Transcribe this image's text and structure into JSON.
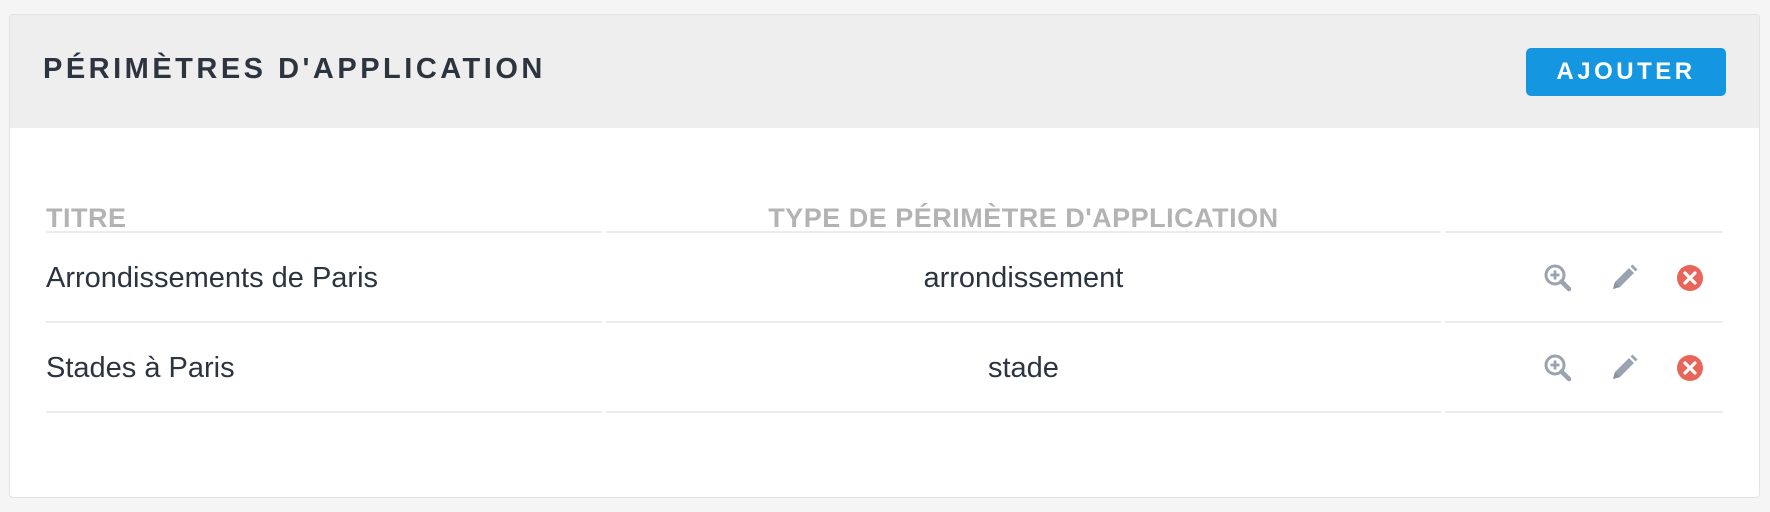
{
  "panel": {
    "title": "PÉRIMÈTRES D'APPLICATION",
    "add_button_label": "AJOUTER"
  },
  "table": {
    "columns": [
      "TITRE",
      "TYPE DE PÉRIMÈTRE D'APPLICATION",
      ""
    ],
    "rows": [
      {
        "title": "Arrondissements de Paris",
        "type": "arrondissement"
      },
      {
        "title": "Stades à Paris",
        "type": "stade"
      }
    ],
    "row_actions": [
      {
        "name": "view",
        "icon": "zoom-in-icon"
      },
      {
        "name": "edit",
        "icon": "pencil-icon"
      },
      {
        "name": "delete",
        "icon": "close-circle-icon"
      }
    ]
  },
  "colors": {
    "header_bg": "#eeeeee",
    "accent": "#1497e0",
    "text": "#2c3440",
    "muted_header": "#b3b3b3",
    "icon_gray": "#9aa3b0",
    "danger": "#e8655a"
  }
}
